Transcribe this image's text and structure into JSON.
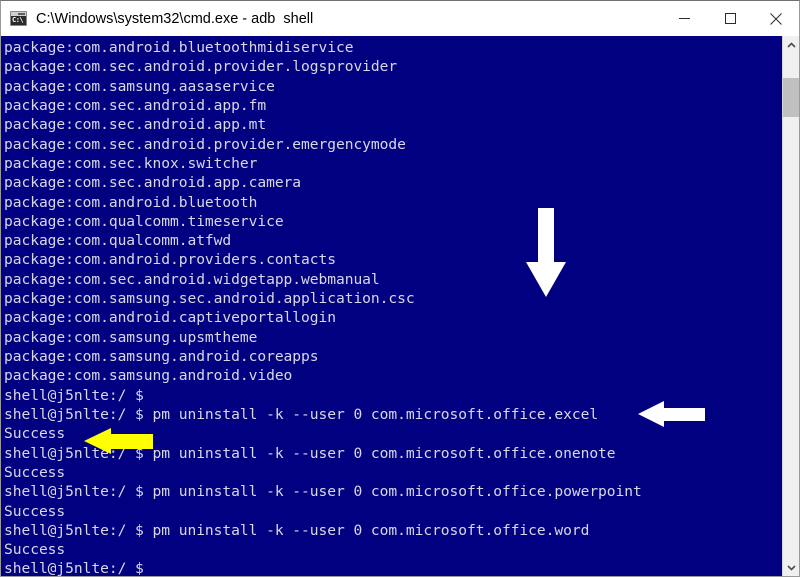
{
  "window": {
    "title": "C:\\Windows\\system32\\cmd.exe - adb  shell",
    "icon": "cmd-console-icon",
    "icon_prompt": "C:\\",
    "background_color": "#000080",
    "text_color": "#d8d8e8",
    "titlebar_color": "#ffffff",
    "controls": {
      "minimize_label": "Minimize",
      "maximize_label": "Maximize",
      "close_label": "Close"
    }
  },
  "scrollbar": {
    "up_label": "Scroll up",
    "down_label": "Scroll down",
    "thumb_label": "Scroll thumb"
  },
  "terminal": {
    "prompt": "shell@j5nlte:/ $",
    "lines": [
      "package:com.android.bluetoothmidiservice",
      "package:com.sec.android.provider.logsprovider",
      "package:com.samsung.aasaservice",
      "package:com.sec.android.app.fm",
      "package:com.sec.android.app.mt",
      "package:com.sec.android.provider.emergencymode",
      "package:com.sec.knox.switcher",
      "package:com.sec.android.app.camera",
      "package:com.android.bluetooth",
      "package:com.qualcomm.timeservice",
      "package:com.qualcomm.atfwd",
      "package:com.android.providers.contacts",
      "package:com.sec.android.widgetapp.webmanual",
      "package:com.samsung.sec.android.application.csc",
      "package:com.android.captiveportallogin",
      "package:com.samsung.upsmtheme",
      "package:com.samsung.android.coreapps",
      "package:com.samsung.android.video",
      "shell@j5nlte:/ $",
      "shell@j5nlte:/ $ pm uninstall -k --user 0 com.microsoft.office.excel",
      "Success",
      "shell@j5nlte:/ $ pm uninstall -k --user 0 com.microsoft.office.onenote",
      "Success",
      "shell@j5nlte:/ $ pm uninstall -k --user 0 com.microsoft.office.powerpoint",
      "Success",
      "shell@j5nlte:/ $ pm uninstall -k --user 0 com.microsoft.office.word",
      "Success",
      "shell@j5nlte:/ $"
    ]
  },
  "annotations": [
    {
      "name": "down-arrow-annotation",
      "direction": "down",
      "color": "#ffffff"
    },
    {
      "name": "left-arrow-annotation-command",
      "direction": "left",
      "color": "#ffffff"
    },
    {
      "name": "left-arrow-annotation-success",
      "direction": "left",
      "color": "#ffff00"
    }
  ]
}
